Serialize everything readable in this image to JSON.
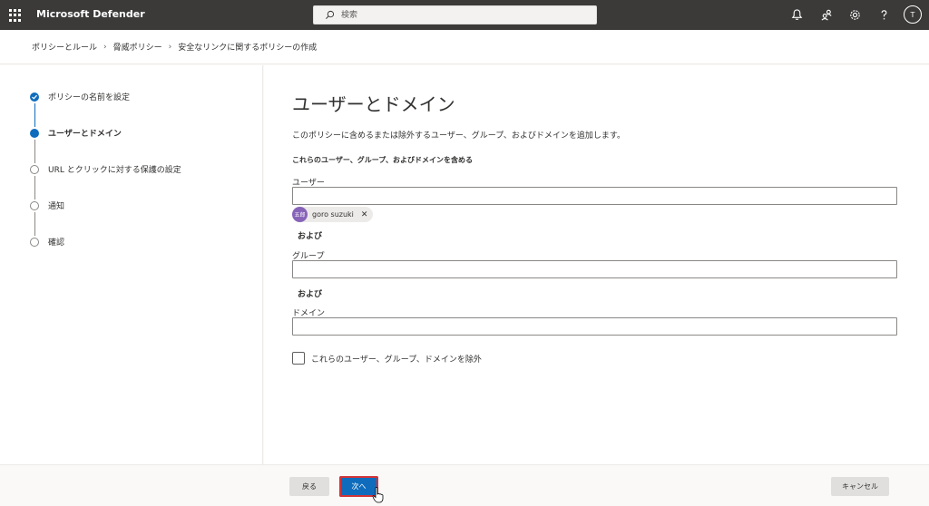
{
  "app": {
    "title": "Microsoft Defender",
    "user_initial": "T"
  },
  "search": {
    "placeholder": "検索"
  },
  "topbar_icons": [
    "bell-icon",
    "people-icon",
    "gear-icon",
    "help-icon"
  ],
  "breadcrumb": [
    "ポリシーとルール",
    "脅威ポリシー",
    "安全なリンクに関するポリシーの作成"
  ],
  "wizard": {
    "steps": [
      {
        "label": "ポリシーの名前を設定",
        "state": "done"
      },
      {
        "label": "ユーザーとドメイン",
        "state": "current"
      },
      {
        "label": "URL とクリックに対する保護の設定",
        "state": "todo"
      },
      {
        "label": "通知",
        "state": "todo"
      },
      {
        "label": "確認",
        "state": "todo"
      }
    ]
  },
  "main": {
    "title": "ユーザーとドメイン",
    "description": "このポリシーに含めるまたは除外するユーザー、グループ、およびドメインを追加します。",
    "include_title": "これらのユーザー、グループ、およびドメインを含める",
    "users_label": "ユーザー",
    "user_chip": {
      "initials": "五郎",
      "name": "goro suzuki"
    },
    "and1": "および",
    "groups_label": "グループ",
    "and2": "および",
    "domains_label": "ドメイン",
    "exclude_checkbox": "これらのユーザー、グループ、ドメインを除外"
  },
  "footer": {
    "back": "戻る",
    "next": "次へ",
    "cancel": "キャンセル"
  },
  "colors": {
    "topbar": "#3b3a39",
    "accent": "#0f6cbd",
    "highlight": "#d13438"
  }
}
